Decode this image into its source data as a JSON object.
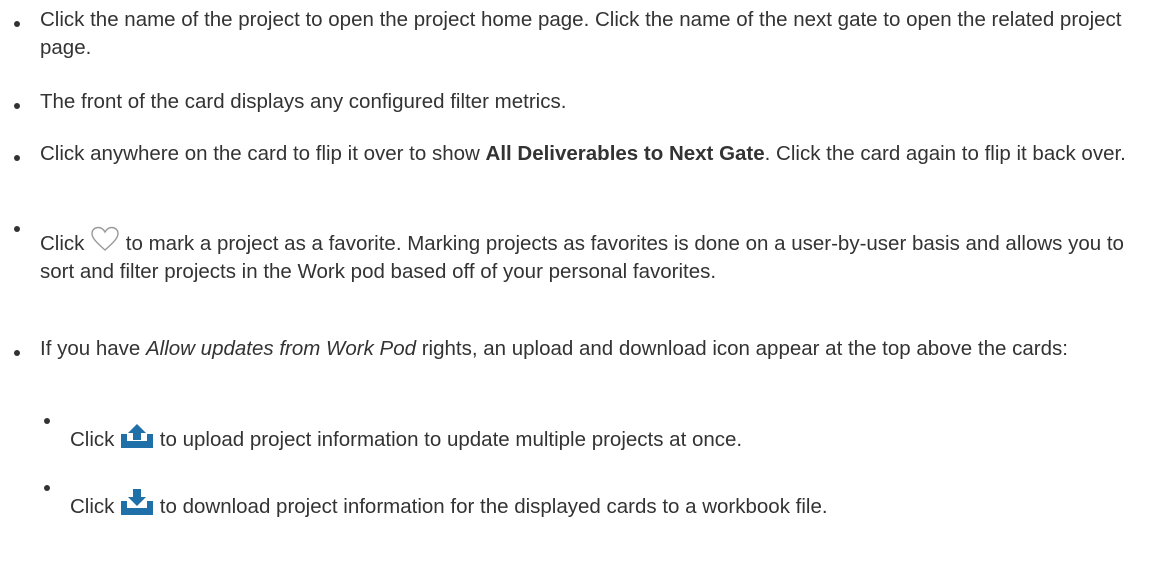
{
  "bullets": [
    {
      "text": "Click the name of the project to open the project home page. Click the name of the next gate to open the related project page."
    },
    {
      "text": "The front of the card displays any configured filter metrics."
    },
    {
      "pre": "Click anywhere on the card to flip it over to show ",
      "bold": "All Deliverables to Next Gate",
      "post": ". Click the card again to flip it back over."
    },
    {
      "pre": "Click ",
      "icon": "heart-outline-icon",
      "post": " to mark a project as a favorite. Marking projects as favorites is done on a user-by-user basis and allows you to sort and filter projects in the Work pod based off of your personal favorites."
    },
    {
      "pre": "If you have ",
      "italic": "Allow updates from Work Pod",
      "post": " rights, an upload and download icon appear at the top above the cards:",
      "sub_bullets": [
        {
          "pre": "Click ",
          "icon": "upload-icon",
          "post": " to upload project information to update multiple projects at once."
        },
        {
          "pre": "Click ",
          "icon": "download-icon",
          "post": " to download project information for the displayed cards to a workbook file."
        }
      ]
    }
  ],
  "colors": {
    "text": "#333333",
    "icon_blue": "#1f6fa8",
    "heart_stroke": "#9a9a9a"
  }
}
